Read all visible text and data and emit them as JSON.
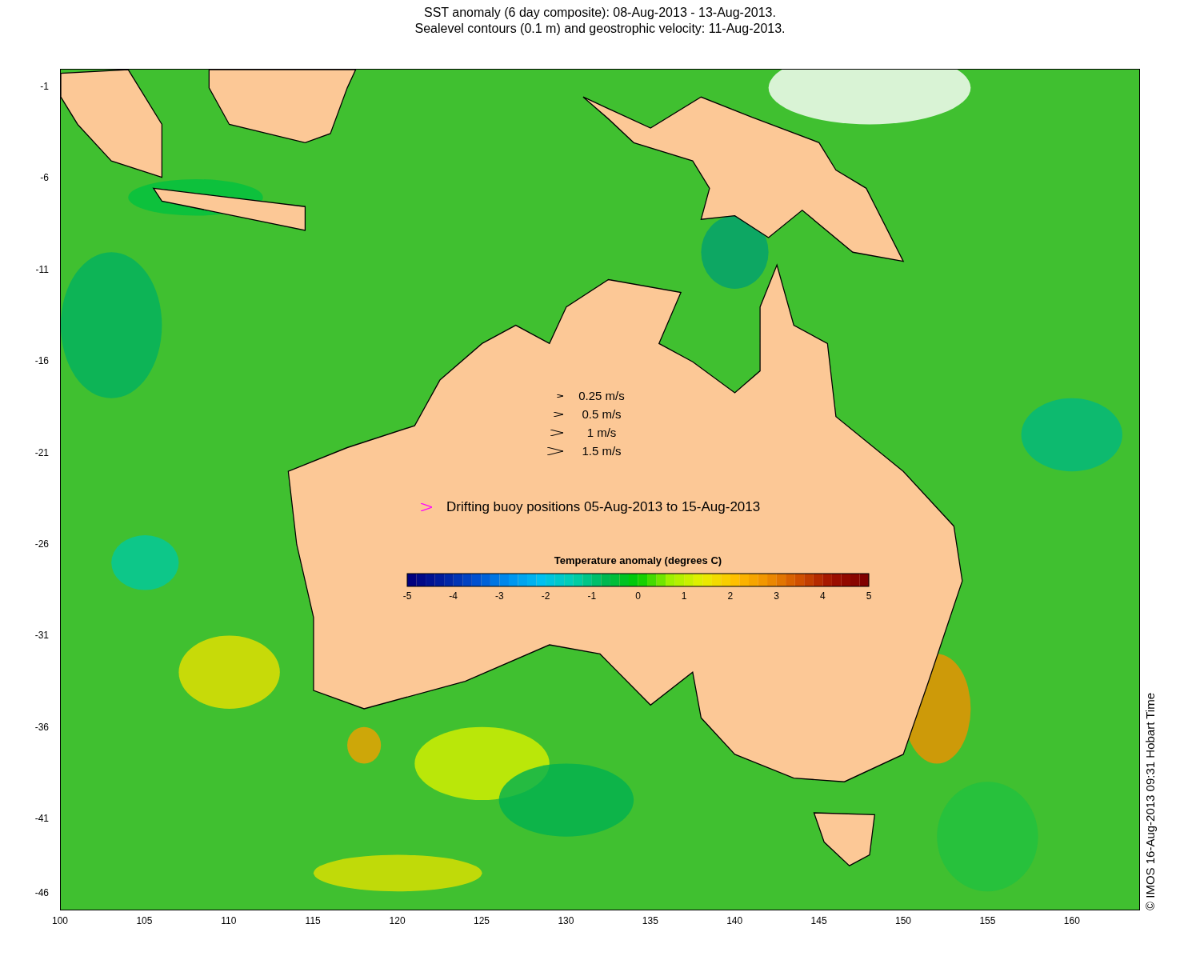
{
  "title": [
    "SST anomaly (6 day composite): 08-Aug-2013 - 13-Aug-2013.",
    "Sealevel contours (0.1 m) and geostrophic velocity: 11-Aug-2013."
  ],
  "y_axis": {
    "ticks": [
      "-1",
      "-6",
      "-11",
      "-16",
      "-21",
      "-26",
      "-31",
      "-36",
      "-41",
      "-46"
    ]
  },
  "x_axis": {
    "ticks": [
      "100",
      "105",
      "110",
      "115",
      "120",
      "125",
      "130",
      "135",
      "140",
      "145",
      "150",
      "155",
      "160"
    ]
  },
  "speed_legend": [
    {
      "label": "0.25 m/s"
    },
    {
      "label": "0.5 m/s"
    },
    {
      "label": "1 m/s"
    },
    {
      "label": "1.5 m/s"
    }
  ],
  "buoy_legend": {
    "label": "Drifting buoy positions 05-Aug-2013 to 15-Aug-2013",
    "color": "#ff00ff"
  },
  "colorbar": {
    "title": "Temperature anomaly (degrees C)",
    "ticks": [
      "-5",
      "-4",
      "-3",
      "-2",
      "-1",
      "0",
      "1",
      "2",
      "3",
      "4",
      "5"
    ]
  },
  "credit": "© IMOS 16-Aug-2013 09:31 Hobart Time"
}
